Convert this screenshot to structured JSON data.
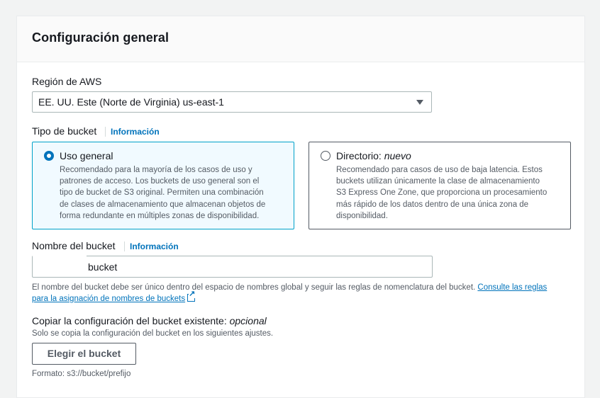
{
  "panel": {
    "title": "Configuración general"
  },
  "region": {
    "label": "Región de AWS",
    "value": "EE. UU. Este (Norte de Virginia) us-east-1",
    "caret_icon": "caret-down-icon"
  },
  "bucket_type": {
    "label": "Tipo de bucket",
    "info": "Información",
    "options": [
      {
        "title": "Uso general",
        "title_suffix": "",
        "selected": true,
        "description": "Recomendado para la mayoría de los casos de uso y patrones de acceso. Los buckets de uso general son el tipo de bucket de S3 original. Permiten una combinación de clases de almacenamiento que almacenan objetos de forma redundante en múltiples zonas de disponibilidad."
      },
      {
        "title": "Directorio: ",
        "title_suffix": "nuevo",
        "selected": false,
        "description": "Recomendado para casos de uso de baja latencia. Estos buckets utilizan únicamente la clase de almacenamiento S3 Express One Zone, que proporciona un procesamiento más rápido de los datos dentro de una única zona de disponibilidad."
      }
    ]
  },
  "bucket_name": {
    "label": "Nombre del bucket",
    "info": "Información",
    "value": "bucket",
    "help_text": "El nombre del bucket debe ser único dentro del espacio de nombres global y seguir las reglas de nomenclatura del bucket.",
    "help_link": "Consulte las reglas para la asignación de nombres de buckets",
    "help_link_icon": "external-link-icon"
  },
  "copy_config": {
    "label": "Copiar la configuración del bucket existente: ",
    "label_optional": "opcional",
    "description": "Solo se copia la configuración del bucket en los siguientes ajustes.",
    "button": "Elegir el bucket",
    "format": "Formato: s3://bucket/prefijo"
  },
  "colors": {
    "link": "#0073bb",
    "selected_border": "#00a1c9",
    "selected_bg": "#f1faff",
    "text": "#16191f",
    "secondary_text": "#545b64"
  }
}
